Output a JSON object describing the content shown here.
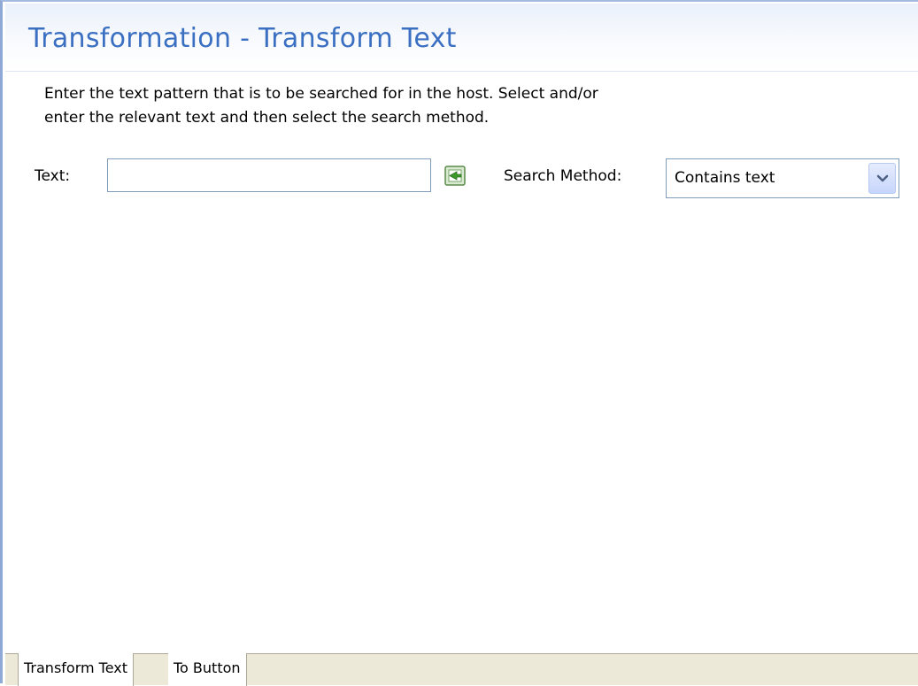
{
  "header": {
    "title": "Transformation - Transform Text"
  },
  "description": {
    "line1": "Enter the text pattern that is to be searched for in the host. Select and/or",
    "line2": "enter the relevant text and then select the search method."
  },
  "form": {
    "text_label": "Text:",
    "text_value": "",
    "text_placeholder": "",
    "insert_icon": "insert-text-icon",
    "search_method_label": "Search Method:",
    "search_method_value": "Contains text",
    "dropdown_icon": "chevron-down-icon"
  },
  "tabs": [
    {
      "label": "Transform Text",
      "active": true
    },
    {
      "label": "To Button",
      "active": false
    }
  ],
  "colors": {
    "title": "#3a6fc1",
    "left_border": "#8fa9d6",
    "tab_bar": "#ece9d8",
    "input_border": "#7f9db9"
  }
}
